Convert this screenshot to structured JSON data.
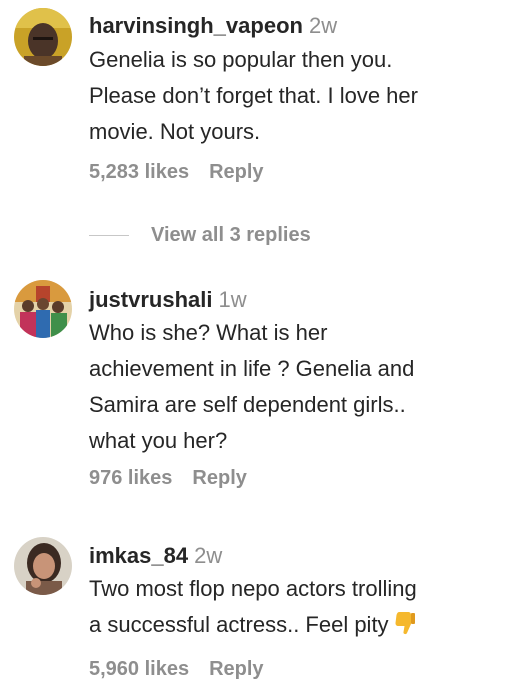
{
  "comments": [
    {
      "username": "harvinsingh_vapeon",
      "time": "2w",
      "lines": [
        "Genelia is so popular then you.",
        "Please don’t forget that. I love her",
        "movie. Not yours."
      ],
      "likes": "5,283 likes",
      "reply": "Reply",
      "view_replies": "View all 3 replies"
    },
    {
      "username": "justvrushali",
      "time": "1w",
      "lines": [
        "Who is she? What is her",
        "achievement in life ? Genelia and",
        "Samira are self dependent girls..",
        "what you her?"
      ],
      "likes": "976 likes",
      "reply": "Reply"
    },
    {
      "username": "imkas_84",
      "time": "2w",
      "lines": [
        "Two most flop nepo actors trolling",
        "a successful actress.. Feel pity"
      ],
      "emoji": "thumbs-down-icon",
      "likes": "5,960 likes",
      "reply": "Reply"
    }
  ],
  "colors": {
    "text": "#262626",
    "secondary": "#8e8e8e",
    "emoji": "#f5b82e"
  }
}
